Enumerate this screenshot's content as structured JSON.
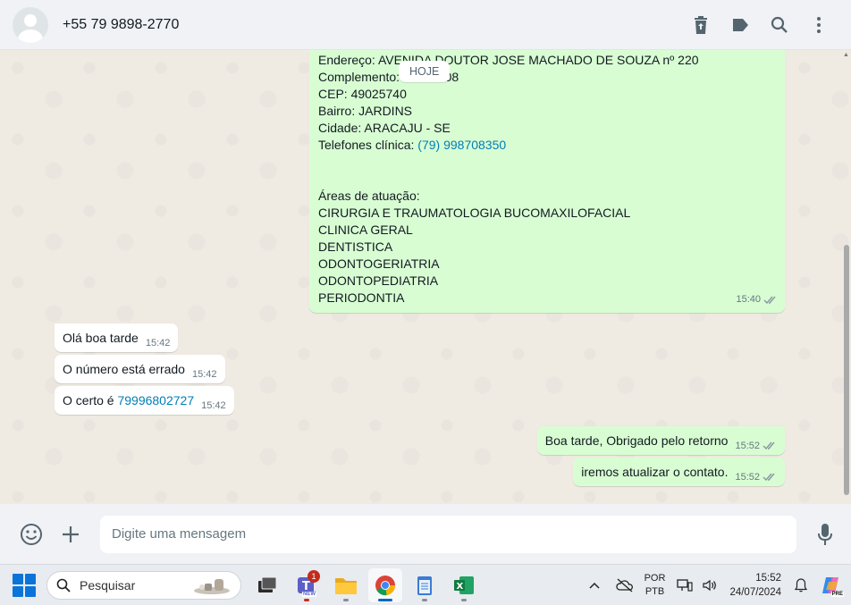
{
  "header": {
    "contact_name": "+55 79 9898-2770",
    "icons": [
      "trash-icon",
      "label-icon",
      "search-icon",
      "menu-dots-icon"
    ]
  },
  "chat": {
    "date_divider": "HOJE",
    "big_message": {
      "lines": [
        {
          "text": "Endereço: AVENIDA DOUTOR JOSE MACHADO DE SOUZA nº 220"
        },
        {
          "text": "Complemento: SALA 308"
        },
        {
          "text": "CEP: 49025740"
        },
        {
          "text": "Bairro: JARDINS"
        },
        {
          "text": "Cidade: ARACAJU - SE"
        },
        {
          "text": "Telefones clínica: ",
          "link": "(79) 998708350"
        },
        {
          "text": ""
        },
        {
          "text": ""
        },
        {
          "text": "Áreas de atuação:"
        },
        {
          "text": "CIRURGIA E TRAUMATOLOGIA BUCOMAXILOFACIAL"
        },
        {
          "text": "CLINICA GERAL"
        },
        {
          "text": "DENTISTICA"
        },
        {
          "text": "ODONTOGERIATRIA"
        },
        {
          "text": "ODONTOPEDIATRIA"
        },
        {
          "text": "PERIODONTIA"
        }
      ],
      "time": "15:40",
      "status": "read"
    },
    "incoming": [
      {
        "text": "Olá boa tarde",
        "time": "15:42"
      },
      {
        "text": "O número está errado",
        "time": "15:42"
      },
      {
        "text": "O certo é ",
        "link": "79996802727",
        "time": "15:42"
      }
    ],
    "outgoing": [
      {
        "text": "Boa tarde, Obrigado pelo retorno",
        "time": "15:52",
        "status": "read"
      },
      {
        "text": "iremos atualizar o contato.",
        "time": "15:52",
        "status": "read"
      }
    ]
  },
  "composer": {
    "placeholder": "Digite uma mensagem"
  },
  "taskbar": {
    "search_label": "Pesquisar",
    "teams_badge": "1",
    "teams_new": "NEW",
    "lang_top": "POR",
    "lang_bottom": "PTB",
    "time": "15:52",
    "date": "24/07/2024",
    "copilot_label": "PRE"
  },
  "colors": {
    "outgoing_bubble": "#d9fdd3",
    "incoming_bubble": "#ffffff",
    "link": "#027eb5",
    "chat_bg": "#efeae2"
  }
}
